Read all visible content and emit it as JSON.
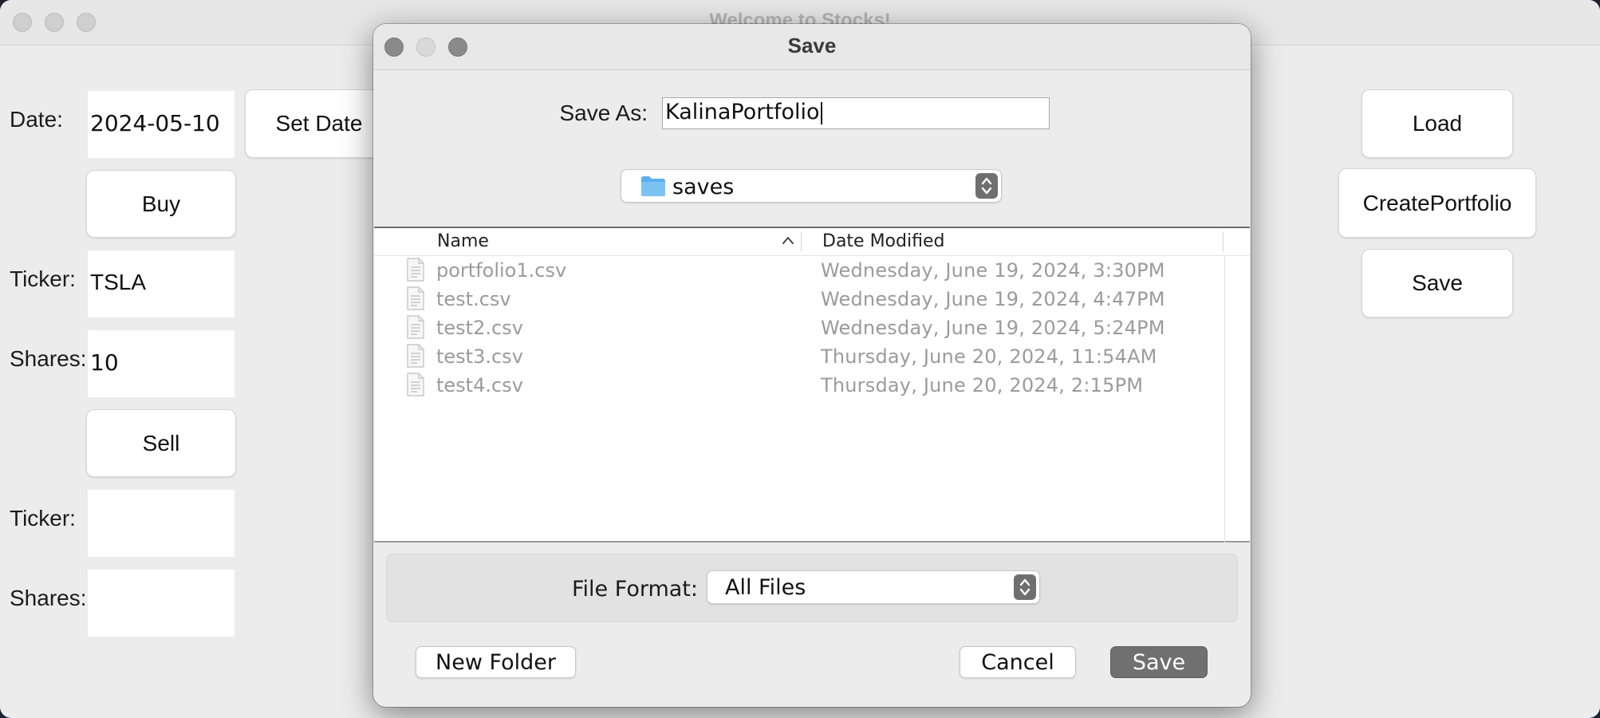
{
  "app": {
    "title": "Welcome to Stocks!"
  },
  "main": {
    "date_label": "Date:",
    "date_value": "2024-05-10",
    "set_date_button": "Set Date",
    "buy_button": "Buy",
    "buy_ticker_label": "Ticker:",
    "buy_ticker_value": "TSLA",
    "buy_shares_label": "Shares:",
    "buy_shares_value": "10",
    "sell_button": "Sell",
    "sell_ticker_label": "Ticker:",
    "sell_ticker_value": "",
    "sell_shares_label": "Shares:",
    "sell_shares_value": "",
    "load_button": "Load",
    "create_portfolio_button": "CreatePortfolio",
    "save_button": "Save"
  },
  "dialog": {
    "title": "Save",
    "save_as_label": "Save As:",
    "save_as_value": "KalinaPortfolio",
    "location": "saves",
    "columns": {
      "name": "Name",
      "date_modified": "Date Modified"
    },
    "files": [
      {
        "name": "portfolio1.csv",
        "date": "Wednesday, June 19, 2024, 3:30PM"
      },
      {
        "name": "test.csv",
        "date": "Wednesday, June 19, 2024, 4:47PM"
      },
      {
        "name": "test2.csv",
        "date": "Wednesday, June 19, 2024, 5:24PM"
      },
      {
        "name": "test3.csv",
        "date": "Thursday, June 20, 2024, 11:54AM"
      },
      {
        "name": "test4.csv",
        "date": "Thursday, June 20, 2024, 2:15PM"
      }
    ],
    "file_format_label": "File Format:",
    "file_format_value": "All Files",
    "new_folder_button": "New Folder",
    "cancel_button": "Cancel",
    "save_button": "Save"
  },
  "icons": {
    "traffic_lights_main": [
      "close-icon",
      "minimize-icon",
      "zoom-icon"
    ],
    "traffic_lights_dialog": [
      "close-icon",
      "minimize-icon",
      "zoom-icon"
    ],
    "location": "folder-icon",
    "file": "document-icon",
    "sort": "chevron-up-icon",
    "select": "stepper-icon"
  },
  "colors": {
    "window_bg": "#ececec",
    "primary_button": "#707070",
    "dimmed_text": "#9b9b9b",
    "folder_blue": "#5ab0ec"
  }
}
